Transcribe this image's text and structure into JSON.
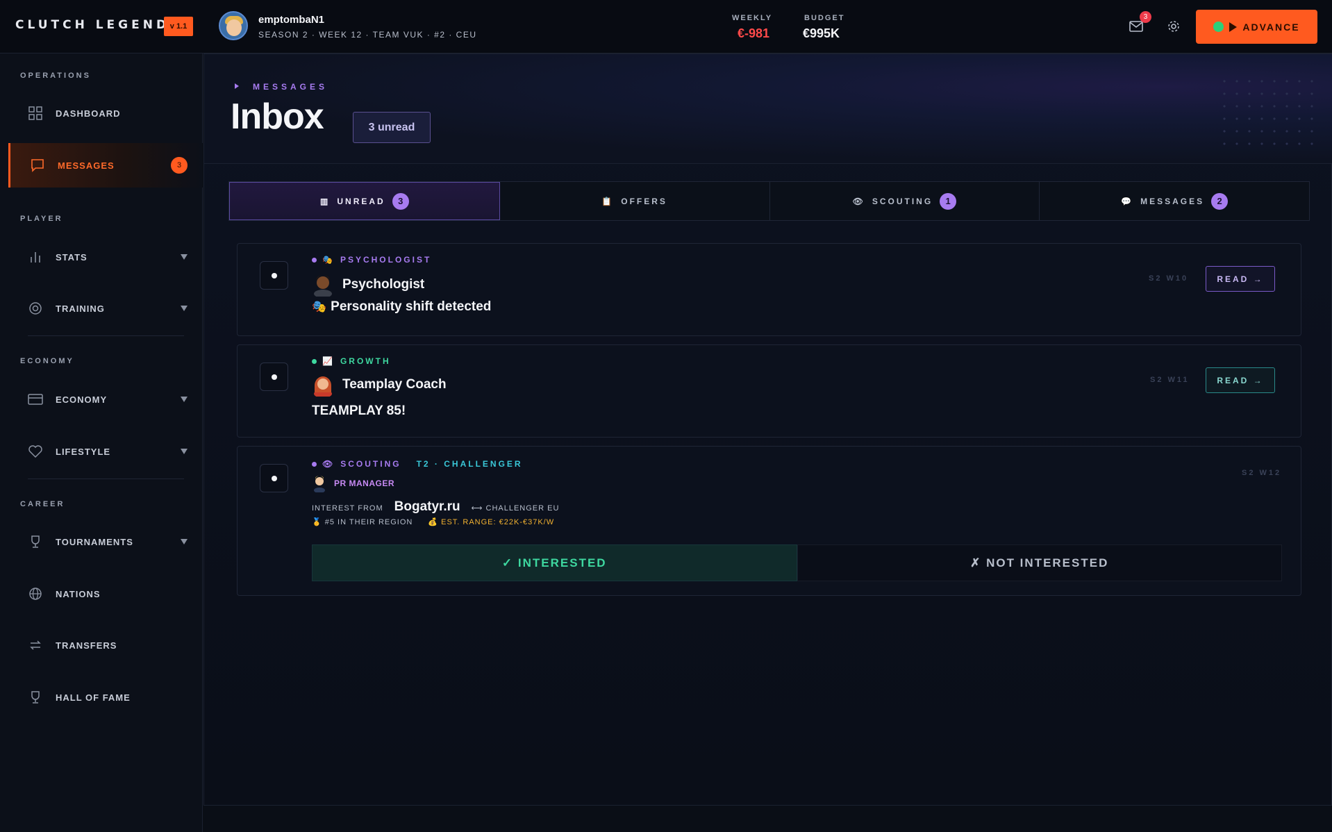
{
  "app": {
    "title": "CLUTCH LEGEND",
    "version": "v 1.1"
  },
  "user": {
    "name": "emptombaN1",
    "meta": "SEASON 2 · WEEK 12 · TEAM VUK · #2 · CEU"
  },
  "stats": {
    "weekly_label": "WEEKLY",
    "weekly_value": "€-981",
    "budget_label": "BUDGET",
    "budget_value": "€995K"
  },
  "header": {
    "mail_count": "3",
    "advance_label": "ADVANCE"
  },
  "colors": {
    "accent": "#ff5a1f",
    "purple": "#a77bf0",
    "green": "#3ed8a0",
    "negative": "#ff4a4a"
  },
  "sidebar": {
    "sections": {
      "operations": "OPERATIONS",
      "player": "PLAYER",
      "economy": "ECONOMY",
      "career": "CAREER"
    },
    "items": [
      {
        "label": "DASHBOARD",
        "icon": "grid-icon"
      },
      {
        "label": "MESSAGES",
        "icon": "chat-icon",
        "badge": "3",
        "active": true
      },
      {
        "label": "STATS",
        "icon": "bar-chart-icon"
      },
      {
        "label": "TRAINING",
        "icon": "target-icon"
      },
      {
        "label": "ECONOMY",
        "icon": "card-icon"
      },
      {
        "label": "LIFESTYLE",
        "icon": "heart-icon"
      },
      {
        "label": "TOURNAMENTS",
        "icon": "trophy-icon"
      },
      {
        "label": "NATIONS",
        "icon": "globe-icon"
      },
      {
        "label": "TRANSFERS",
        "icon": "transfer-icon"
      },
      {
        "label": "HALL OF FAME",
        "icon": "trophy-icon"
      }
    ]
  },
  "page": {
    "crumb": "MESSAGES",
    "title": "Inbox",
    "unread_pill": "3 unread"
  },
  "tabs": [
    {
      "label": "UNREAD",
      "icon": "▥",
      "badge": "3"
    },
    {
      "label": "OFFERS",
      "icon": "📋",
      "badge": ""
    },
    {
      "label": "SCOUTING",
      "icon": "👁",
      "badge": "1"
    },
    {
      "label": "MESSAGES",
      "icon": "💬",
      "badge": "2"
    }
  ],
  "messages": [
    {
      "category": "PSYCHOLOGIST",
      "category_emoji": "🎭",
      "sender": "Psychologist",
      "subject": "Personality shift detected",
      "subject_emoji": "🎭",
      "date": "S2 W10",
      "action": "READ →"
    },
    {
      "category": "GROWTH",
      "category_emoji": "📈",
      "sender": "Teamplay Coach",
      "subject": "TEAMPLAY 85!",
      "date": "S2 W11",
      "action": "READ →"
    },
    {
      "category": "SCOUTING",
      "category_emoji": "👁",
      "tier": "T2 · CHALLENGER",
      "sender": "PR MANAGER",
      "interest_from": "INTEREST FROM",
      "team": "Bogatyr.ru",
      "league": "⟷ CHALLENGER EU",
      "region_rank": "🥇 #5 IN THEIR REGION",
      "est_range": "💰 EST. RANGE: €22K-€37K/W",
      "date": "S2 W12",
      "yes_label": "✓ INTERESTED",
      "no_label": "✗ NOT INTERESTED"
    }
  ]
}
